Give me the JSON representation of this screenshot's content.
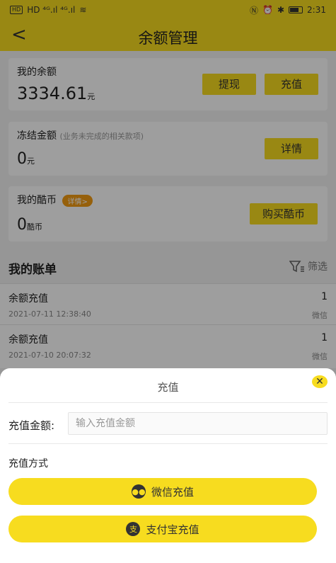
{
  "status_bar": {
    "left_icons": "HD ⁴ᴳ.ıl ⁴ᴳ.ıl",
    "time": "2:31"
  },
  "header": {
    "title": "余额管理",
    "back": "<"
  },
  "balance": {
    "label": "我的余额",
    "amount": "3334.61",
    "unit": "元",
    "withdraw": "提现",
    "recharge": "充值"
  },
  "frozen": {
    "label": "冻结金额",
    "note": "(业务未完成的相关款项)",
    "amount": "0",
    "unit": "元",
    "detail": "详情"
  },
  "coins": {
    "label": "我的酷币",
    "badge": "详情>",
    "amount": "0",
    "unit": "酷币",
    "buy": "购买酷币"
  },
  "bills": {
    "title": "我的账单",
    "filter": "筛选",
    "items": [
      {
        "name": "余额充值",
        "amount": "1",
        "time": "2021-07-11 12:38:40",
        "method": "微信"
      },
      {
        "name": "余额充值",
        "amount": "1",
        "time": "2021-07-10 20:07:32",
        "method": "微信"
      }
    ]
  },
  "sheet": {
    "title": "充值",
    "amount_label": "充值金额:",
    "amount_placeholder": "输入充值金额",
    "method_label": "充值方式",
    "wechat_label": "微信充值",
    "alipay_label": "支付宝充值"
  },
  "colors": {
    "accent": "#f7dc1f",
    "badge": "#f39c12"
  }
}
